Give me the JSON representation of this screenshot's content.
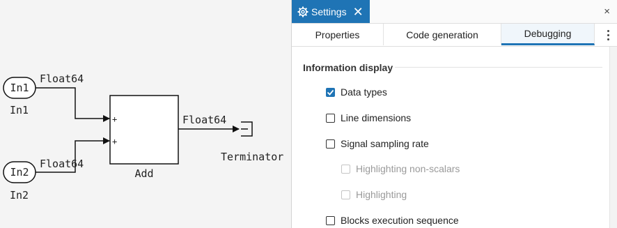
{
  "canvas": {
    "blocks": {
      "in1": {
        "text": "In1",
        "name": "In1"
      },
      "in2": {
        "text": "In2",
        "name": "In2"
      },
      "add": {
        "name": "Add",
        "port1": "+",
        "port2": "+"
      },
      "terminator": {
        "name": "Terminator"
      }
    },
    "signals": {
      "in1_type": "Float64",
      "in2_type": "Float64",
      "add_out_type": "Float64"
    }
  },
  "panel": {
    "title": "Settings",
    "close_symbol": "×",
    "title_close_symbol": "✕",
    "tabs": [
      {
        "label": "Properties",
        "active": false
      },
      {
        "label": "Code generation",
        "active": false
      },
      {
        "label": "Debugging",
        "active": true
      }
    ],
    "section": {
      "title": "Information display",
      "options": [
        {
          "label": "Data types",
          "checked": true,
          "disabled": false
        },
        {
          "label": "Line dimensions",
          "checked": false,
          "disabled": false
        },
        {
          "label": "Signal sampling rate",
          "checked": false,
          "disabled": false
        },
        {
          "label": "Highlighting non-scalars",
          "checked": false,
          "disabled": true
        },
        {
          "label": "Highlighting",
          "checked": false,
          "disabled": true
        },
        {
          "label": "Blocks execution sequence",
          "checked": false,
          "disabled": false
        }
      ]
    }
  },
  "colors": {
    "accent": "#1f74b5",
    "canvas_bg": "#f4f4f4"
  }
}
